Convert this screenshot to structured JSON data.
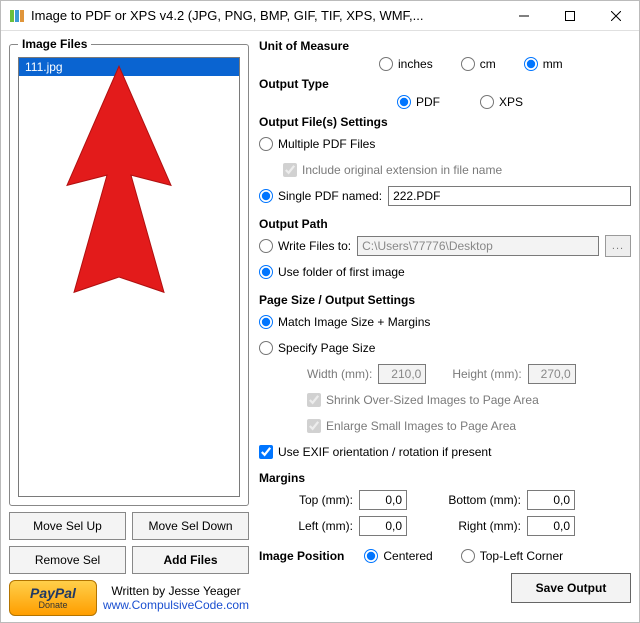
{
  "titlebar": {
    "title": "Image to PDF or XPS  v4.2   (JPG, PNG, BMP, GIF, TIF, XPS, WMF,..."
  },
  "left": {
    "group_label": "Image Files",
    "list": [
      "111.jpg"
    ],
    "move_up": "Move Sel Up",
    "move_down": "Move Sel Down",
    "remove": "Remove Sel",
    "add": "Add Files"
  },
  "footer": {
    "donate_main": "PayPal",
    "donate_small": "Donate",
    "written": "Written by Jesse Yeager",
    "url": "www.CompulsiveCode.com"
  },
  "unit": {
    "heading": "Unit of Measure",
    "inches": "inches",
    "cm": "cm",
    "mm": "mm"
  },
  "output_type": {
    "heading": "Output Type",
    "pdf": "PDF",
    "xps": "XPS"
  },
  "output_files": {
    "heading": "Output File(s) Settings",
    "multiple_label": "Multiple PDF Files",
    "include_ext": "Include original extension in file name",
    "single_label": "Single PDF named:",
    "single_value": "222.PDF"
  },
  "output_path": {
    "heading": "Output Path",
    "write_to_label": "Write Files to:",
    "write_to_value": "C:\\Users\\77776\\Desktop",
    "use_folder": "Use folder of first image",
    "browse": "..."
  },
  "page_size": {
    "heading": "Page Size / Output Settings",
    "match": "Match Image Size + Margins",
    "specify": "Specify Page Size",
    "width_label": "Width (mm):",
    "width_value": "210,0",
    "height_label": "Height (mm):",
    "height_value": "270,0",
    "shrink": "Shrink Over-Sized Images to Page Area",
    "enlarge": "Enlarge Small Images to Page Area",
    "exif": "Use EXIF orientation / rotation if present"
  },
  "margins": {
    "heading": "Margins",
    "top_label": "Top (mm):",
    "top_value": "0,0",
    "bottom_label": "Bottom (mm):",
    "bottom_value": "0,0",
    "left_label": "Left (mm):",
    "left_value": "0,0",
    "right_label": "Right (mm):",
    "right_value": "0,0"
  },
  "image_position": {
    "heading": "Image Position",
    "centered": "Centered",
    "topleft": "Top-Left Corner"
  },
  "save_button": "Save Output"
}
